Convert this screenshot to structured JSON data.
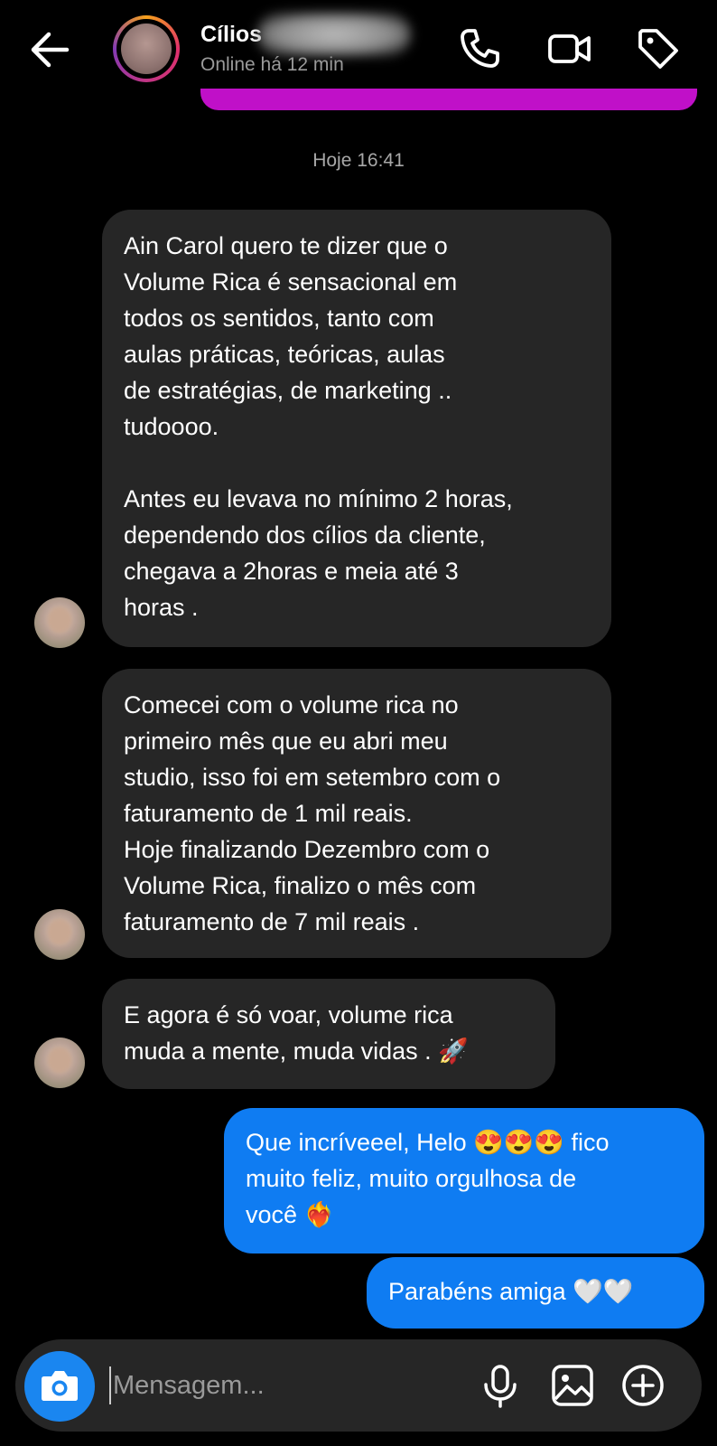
{
  "header": {
    "contact_name": "Cílios",
    "status": "Online há 12 min",
    "icons": [
      "back-arrow-icon",
      "phone-icon",
      "video-camera-icon",
      "tag-icon"
    ]
  },
  "timestamp": "Hoje 16:41",
  "messages": [
    {
      "direction": "incoming",
      "text": "Ain Carol quero te dizer que o\nVolume Rica é sensacional em\ntodos os sentidos, tanto com\naulas práticas, teóricas, aulas\nde estratégias, de marketing ..\ntudoooo.\n\nAntes eu levava no mínimo 2 horas,\ndependendo dos cílios da cliente,\nchegava a 2horas e meia até 3\nhoras ."
    },
    {
      "direction": "incoming",
      "text": "Comecei com o volume rica no\nprimeiro mês que eu abri meu\nstudio, isso foi em setembro com o\nfaturamento de 1 mil reais.\nHoje finalizando Dezembro com o\nVolume Rica, finalizo o mês com\nfaturamento de 7 mil reais ."
    },
    {
      "direction": "incoming",
      "text": "E agora é só voar, volume rica\nmuda a mente, muda vidas . 🚀"
    },
    {
      "direction": "outgoing",
      "text": "Que incríveeel, Helo 😍😍😍 fico\nmuito feliz, muito orgulhosa de\nvocê ❤️‍🔥"
    },
    {
      "direction": "outgoing",
      "text": "Parabéns amiga 🤍🤍"
    }
  ],
  "composer": {
    "placeholder": "Mensagem...",
    "icons": [
      "camera-icon",
      "microphone-icon",
      "gallery-icon",
      "plus-icon"
    ]
  },
  "colors": {
    "background": "#000000",
    "incoming_bubble": "#262626",
    "outgoing_bubble": "#0f7cf2",
    "accent_strip": "#c010c8",
    "camera_button": "#1a86f0"
  }
}
